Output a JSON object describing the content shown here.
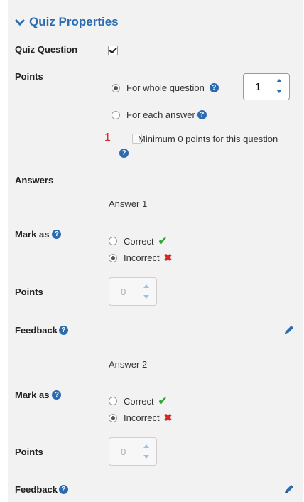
{
  "header": {
    "title": "Quiz Properties"
  },
  "quiz_question": {
    "label": "Quiz Question",
    "checked": true
  },
  "points_section": {
    "label": "Points",
    "whole_label": "For whole question",
    "each_label": "For each answer",
    "spinner_value": "1",
    "minimum_label": "Minimum 0 points for this question",
    "annotation": "1"
  },
  "answers_section": {
    "label": "Answers",
    "answers": [
      {
        "title": "Answer 1",
        "mark_as_label": "Mark as",
        "correct_label": "Correct",
        "incorrect_label": "Incorrect",
        "selected": "incorrect",
        "points_label": "Points",
        "points_value": "0",
        "feedback_label": "Feedback"
      },
      {
        "title": "Answer 2",
        "mark_as_label": "Mark as",
        "correct_label": "Correct",
        "incorrect_label": "Incorrect",
        "selected": "incorrect",
        "points_label": "Points",
        "points_value": "0",
        "feedback_label": "Feedback"
      }
    ]
  },
  "colors": {
    "accent": "#2b6cb0",
    "correct": "#2fa52f",
    "incorrect": "#e02424"
  }
}
